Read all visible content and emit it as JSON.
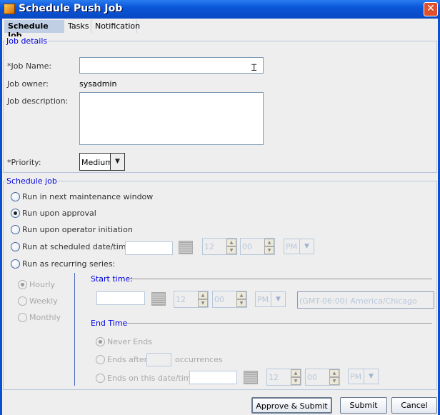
{
  "window": {
    "title": "Schedule Push Job",
    "close": "✕"
  },
  "tabs": [
    {
      "label": "Schedule Job",
      "active": true
    },
    {
      "label": "Tasks"
    },
    {
      "label": "Notification"
    }
  ],
  "job_details": {
    "legend": "Job details",
    "job_name_label": "*Job Name:",
    "job_name_value": "",
    "job_owner_label": "Job owner:",
    "job_owner_value": "sysadmin",
    "job_description_label": "Job description:",
    "job_description_value": "",
    "priority_label": "*Priority:",
    "priority_value": "Medium"
  },
  "schedule": {
    "legend": "Schedule job",
    "options": [
      {
        "label": "Run in next maintenance window",
        "selected": false
      },
      {
        "label": "Run upon approval",
        "selected": true
      },
      {
        "label": "Run upon operator initiation",
        "selected": false
      },
      {
        "label": "Run at scheduled date/time:",
        "selected": false
      },
      {
        "label": "Run as recurring series:",
        "selected": false
      }
    ],
    "scheduled": {
      "date": "",
      "hour": "12",
      "minute": "00",
      "ampm": "PM"
    },
    "recurrence": [
      {
        "label": "Hourly",
        "selected": true
      },
      {
        "label": "Weekly",
        "selected": false
      },
      {
        "label": "Monthly",
        "selected": false
      }
    ],
    "start_time": {
      "legend": "Start time:",
      "date": "",
      "hour": "12",
      "minute": "00",
      "ampm": "PM",
      "timezone": "(GMT-06:00) America/Chicago"
    },
    "end_time": {
      "legend": "End Time",
      "never_ends": "Never Ends",
      "ends_after": "Ends after",
      "occurrences": "occurrences",
      "ends_on": "Ends on this date/time",
      "date": "",
      "hour": "12",
      "minute": "00",
      "ampm": "PM"
    }
  },
  "buttons": {
    "approve_submit": "Approve & Submit",
    "submit": "Submit",
    "cancel": "Cancel"
  }
}
